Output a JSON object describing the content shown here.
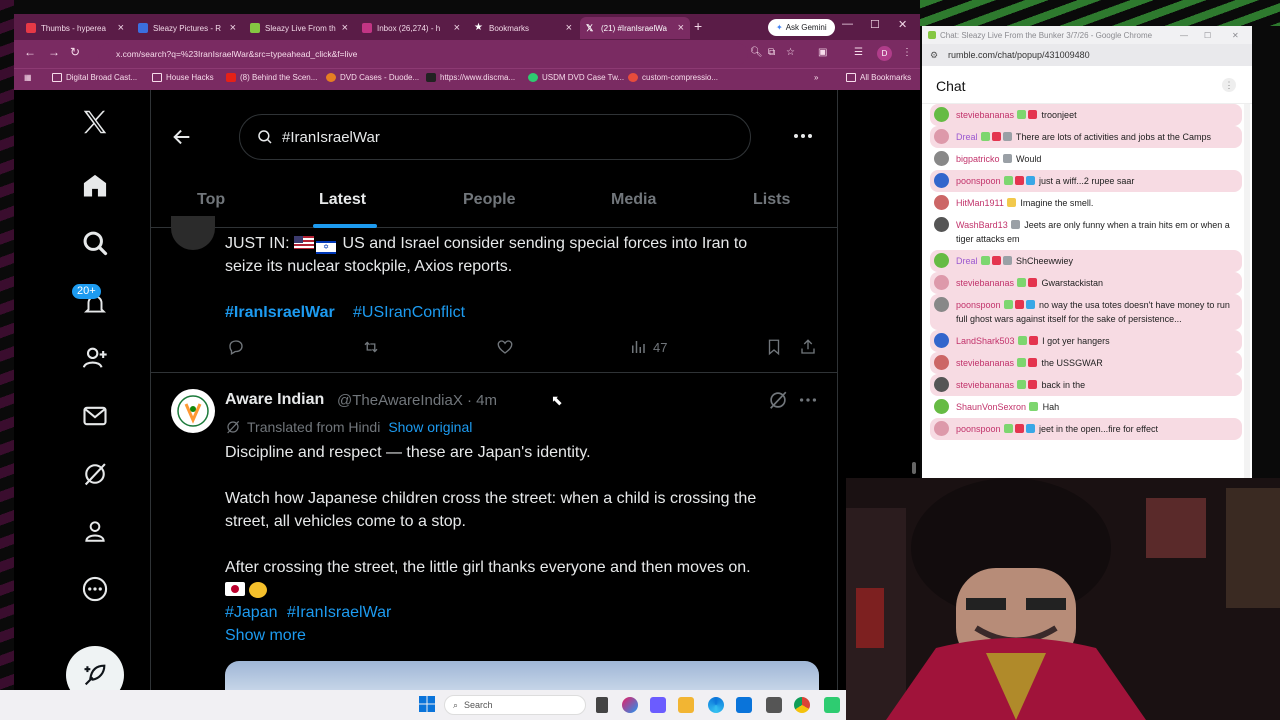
{
  "browser": {
    "tabs": [
      {
        "title": "Thumbs - hyperea",
        "color": "#e63946"
      },
      {
        "title": "Sleazy Pictures - R",
        "color": "#3b6fe0"
      },
      {
        "title": "Sleazy Live From th",
        "color": "#85c742"
      },
      {
        "title": "Inbox (26,274) - h",
        "color": "#c13584"
      },
      {
        "title": "Bookmarks",
        "color": "#ffffff"
      },
      {
        "title": "(21) #IranIsraelWa",
        "color": "#000000"
      }
    ],
    "gemini_label": "Ask Gemini",
    "url": "x.com/search?q=%23IranIsraelWar&src=typeahead_click&f=live",
    "profile_initial": "D",
    "bookmarks": [
      "Digital Broad Cast...",
      "House Hacks",
      "(8) Behind the Scen...",
      "DVD Cases - Duode...",
      "https://www.discma...",
      "USDM DVD Case Tw...",
      "custom-compressio..."
    ],
    "all_bookmarks": "All Bookmarks"
  },
  "x": {
    "notification_count": "20+",
    "search_query": "#IranIsraelWar",
    "tabs": [
      "Top",
      "Latest",
      "People",
      "Media",
      "Lists"
    ],
    "tweet1": {
      "line1": "JUST IN: 🇺🇸🇮🇱 US and Israel consider sending special forces into Iran to",
      "line1_text": "JUST IN:",
      "line1_rest": "US and Israel consider sending special forces into Iran to",
      "line2": "seize its nuclear stockpile, Axios reports.",
      "hashtags": [
        "#IranIsraelWar",
        "#USIranConflict"
      ],
      "views": "47"
    },
    "tweet2": {
      "name": "Aware Indian",
      "handle": "@TheAwareIndiaX · 4m",
      "translated": "Translated from Hindi",
      "show_original": "Show original",
      "p1": "Discipline and respect — these are Japan's identity.",
      "p2a": "Watch how Japanese children cross the street: when a child is crossing the",
      "p2b": "street, all vehicles come to a stop.",
      "p3": "After crossing the street, the little girl thanks everyone and then moves on.",
      "hashtags": [
        "#Japan",
        "#IranIsraelWar"
      ],
      "show_more": "Show more"
    }
  },
  "chat": {
    "window_title": "Chat: Sleazy Live From the Bunker 3/7/26 - Google Chrome",
    "url": "rumble.com/chat/popup/431009480",
    "header": "Chat",
    "messages": [
      {
        "user": "steviebananas",
        "color": "#c2336b",
        "text": "troonjeet",
        "hl": true,
        "badges": [
          "bg",
          "br"
        ]
      },
      {
        "user": "Dreal",
        "color": "#9b59d0",
        "text": "There are lots of activities and jobs at the Camps",
        "hl": true,
        "badges": [
          "bg",
          "br",
          "bz"
        ]
      },
      {
        "user": "bigpatricko",
        "color": "#c2336b",
        "text": "Would",
        "hl": false,
        "badges": [
          "bz"
        ]
      },
      {
        "user": "poonspoon",
        "color": "#c2336b",
        "text": "just a wiff...2 rupee saar",
        "hl": true,
        "badges": [
          "bg",
          "br",
          "bb"
        ]
      },
      {
        "user": "HitMan1911",
        "color": "#c2336b",
        "text": "Imagine the smell.",
        "hl": false,
        "badges": [
          "by"
        ]
      },
      {
        "user": "WashBard13",
        "color": "#c2336b",
        "text": "Jeets are only funny when a train hits em or when a tiger attacks em",
        "hl": false,
        "badges": [
          "bz"
        ]
      },
      {
        "user": "Dreal",
        "color": "#9b59d0",
        "text": "ShCheewwiey",
        "hl": true,
        "badges": [
          "bg",
          "br",
          "bz"
        ]
      },
      {
        "user": "steviebananas",
        "color": "#c2336b",
        "text": "Gwarstackistan",
        "hl": true,
        "badges": [
          "bg",
          "br"
        ]
      },
      {
        "user": "poonspoon",
        "color": "#c2336b",
        "text": "no way the usa totes doesn't have money to run full ghost wars against itself for the sake of persistence...",
        "hl": true,
        "badges": [
          "bg",
          "br",
          "bb"
        ]
      },
      {
        "user": "LandShark503",
        "color": "#c2336b",
        "text": "I got yer hangers",
        "hl": true,
        "badges": [
          "bg",
          "br"
        ]
      },
      {
        "user": "steviebananas",
        "color": "#c2336b",
        "text": "the USSGWAR",
        "hl": true,
        "badges": [
          "bg",
          "br"
        ]
      },
      {
        "user": "steviebananas",
        "color": "#c2336b",
        "text": "back in the",
        "hl": true,
        "badges": [
          "bg",
          "br"
        ]
      },
      {
        "user": "ShaunVonSexron",
        "color": "#c2336b",
        "text": "Hah",
        "hl": false,
        "badges": [
          "bg"
        ]
      },
      {
        "user": "poonspoon",
        "color": "#c2336b",
        "text": "jeet in the open...fire for effect",
        "hl": true,
        "badges": [
          "bg",
          "br",
          "bb"
        ]
      }
    ]
  },
  "taskbar": {
    "search_label": "Search"
  }
}
